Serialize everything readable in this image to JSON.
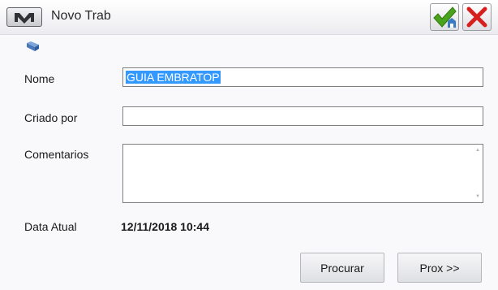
{
  "window": {
    "title": "Novo Trab",
    "menu_icon": "m-logo-icon",
    "confirm_icon": "checkmark-icon",
    "close_icon": "red-x-icon"
  },
  "form": {
    "folder_icon": "folder-icon",
    "nome_label": "Nome",
    "nome_value": "GUIA EMBRATOP",
    "criado_por_label": "Criado por",
    "criado_por_value": "",
    "comentarios_label": "Comentarios",
    "comentarios_value": "",
    "data_atual_label": "Data Atual",
    "data_atual_value": "12/11/2018 10:44"
  },
  "buttons": {
    "procurar_label": "Procurar",
    "prox_label": "Prox >>"
  },
  "colors": {
    "selection": "#3399ff",
    "check_green": "#4aa31c",
    "close_red": "#d6201f",
    "title_bar": "#ececf0"
  }
}
